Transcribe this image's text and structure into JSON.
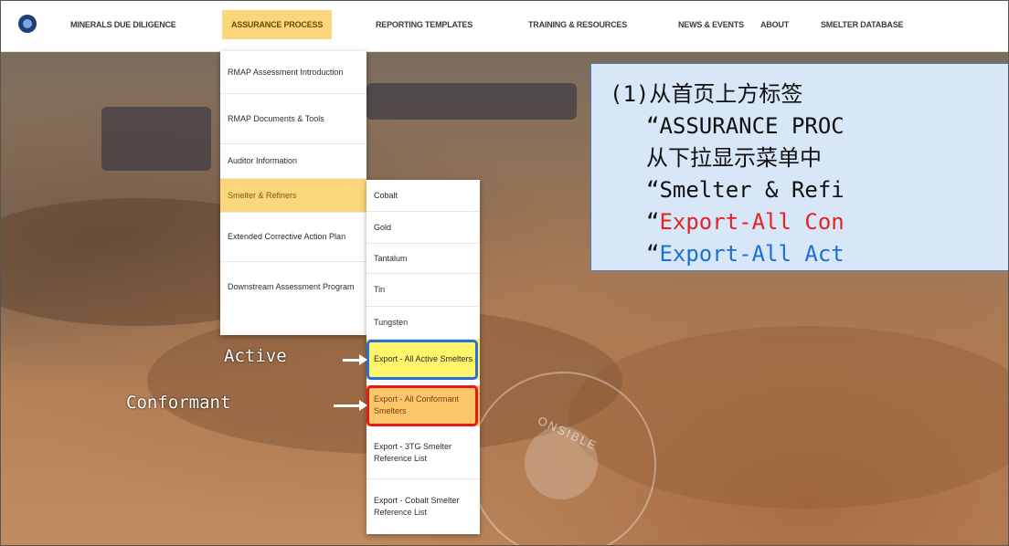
{
  "nav": {
    "items": [
      "MINERALS DUE DILIGENCE",
      "ASSURANCE PROCESS",
      "REPORTING TEMPLATES",
      "TRAINING & RESOURCES",
      "NEWS & EVENTS",
      "ABOUT",
      "SMELTER DATABASE"
    ],
    "active_item": "ASSURANCE PROCESS"
  },
  "dropdown": {
    "items": [
      "RMAP Assessment Introduction",
      "RMAP Documents & Tools",
      "Auditor Information",
      "Smelter & Refiners",
      "Extended Corrective Action Plan",
      "Downstream Assessment Program"
    ],
    "highlighted": "Smelter & Refiners"
  },
  "submenu": {
    "items": [
      "Cobalt",
      "Gold",
      "Tantalum",
      "Tin",
      "Tungsten",
      "Export - All Active Smelters",
      "Export - All Conformant Smelters",
      "Export - 3TG Smelter Reference List",
      "Export - Cobalt Smelter Reference List"
    ]
  },
  "annotations": {
    "active_label": "Active",
    "conformant_label": "Conformant",
    "arrow_glyph": "→"
  },
  "callout": {
    "line1": "(1)从首页上方标签",
    "line2": "“ASSURANCE PROC",
    "line3": "从下拉显示菜单中",
    "line4": "“Smelter & Refi",
    "line5_open_quote": "“",
    "line5_text": "Export-All Con",
    "line6_open_quote": "“",
    "line6_text": "Export-All Act"
  },
  "watermark": {
    "text": "ONSIBLE"
  },
  "colors": {
    "active_tab_bg": "#fbd67a",
    "active_box": "#2a6fd6",
    "conformant_box": "#e51a1a",
    "callout_bg": "#d7e7f8",
    "callout_red": "#e42323",
    "callout_blue": "#1c6fd4"
  },
  "icons": {
    "site_logo": "globe-logo-icon"
  }
}
